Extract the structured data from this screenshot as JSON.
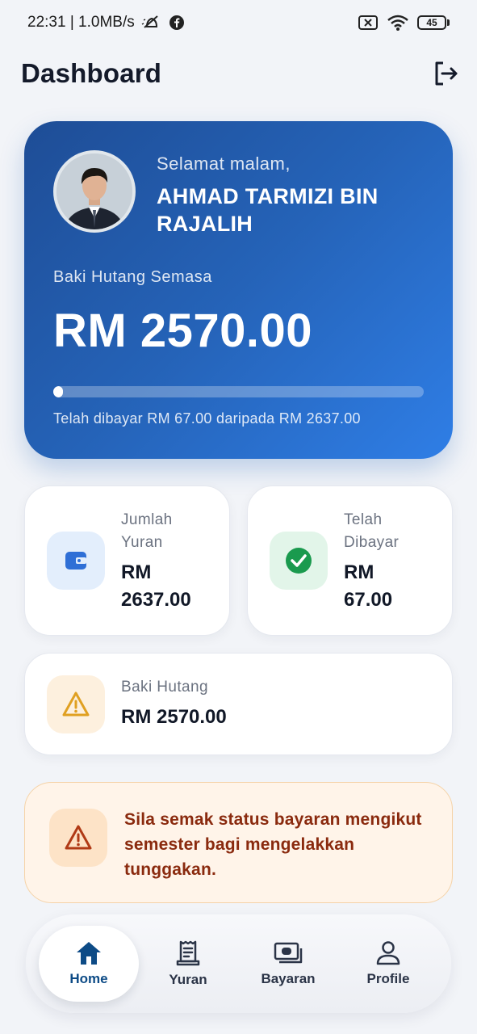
{
  "status_bar": {
    "time_speed": "22:31 | 1.0MB/s",
    "battery": "45"
  },
  "header": {
    "title": "Dashboard"
  },
  "hero": {
    "greeting": "Selamat malam,",
    "user_name": "AHMAD TARMIZI BIN RAJALIH",
    "balance_label": "Baki Hutang Semasa",
    "balance_amount": "RM 2570.00",
    "paid_fraction": 0.0254,
    "paid_text": "Telah dibayar RM 67.00 daripada RM 2637.00"
  },
  "stats": {
    "total_fees": {
      "label": "Jumlah Yuran",
      "value": "RM 2637.00",
      "icon": "wallet-icon",
      "color": "#2f6fd6",
      "bg": "#e3eefc"
    },
    "paid": {
      "label": "Telah Dibayar",
      "value": "RM 67.00",
      "icon": "check-circle-icon",
      "color": "#1a9a4e",
      "bg": "#e2f5e9"
    },
    "balance": {
      "label": "Baki Hutang",
      "value": "RM 2570.00",
      "icon": "warning-icon",
      "color": "#e0a021",
      "bg": "#fdf0de"
    }
  },
  "notice": {
    "text": "Sila semak status bayaran mengikut semester bagi mengelakkan tunggakan.",
    "icon": "warning-icon",
    "color": "#b03a16"
  },
  "nav": {
    "items": [
      {
        "label": "Home",
        "icon": "home-icon",
        "active": true
      },
      {
        "label": "Yuran",
        "icon": "receipt-icon",
        "active": false
      },
      {
        "label": "Bayaran",
        "icon": "payment-icon",
        "active": false
      },
      {
        "label": "Profile",
        "icon": "person-icon",
        "active": false
      }
    ]
  }
}
